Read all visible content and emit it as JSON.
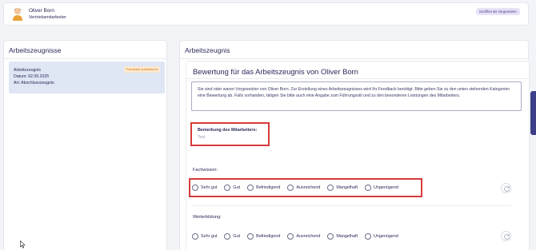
{
  "header": {
    "user_name": "Oliver Born",
    "user_role": "Vertriebsmitarbeiter",
    "badge": "Geöffnet als Vorgesetzter"
  },
  "left": {
    "title": "Arbeitszeugnisse",
    "item": {
      "title": "Arbeitszeugnis",
      "date": "Datum: 02.09.2025",
      "type": "Art: Abschlusszeugnis",
      "badge": "Feedback ausstehend"
    }
  },
  "right": {
    "title": "Arbeitszeugnis",
    "heading": "Bewertung für das Arbeitszeugnis von Oliver Born",
    "info": "Sie sind oder waren Vorgesetzter von Oliver Born. Zur Erstellung eines Arbeitszeugnisses wird Ihr Feedback benötigt. Bitte geben Sie zu den unten stehenden Kategorien eine Bewertung ab. Falls vorhanden, tätigen Sie bitte auch eine Angabe zum Führungsstil und zu den besonderen Leistungen des Mitarbeiters.",
    "remark_label": "Bemerkung des Mitarbeiters:",
    "remark_value": "Test",
    "sections": [
      {
        "label": "Fachwissen:"
      },
      {
        "label": "Weiterbildung:"
      }
    ],
    "options": [
      "Sehr gut",
      "Gut",
      "Befriedigend",
      "Ausreichend",
      "Mangelhaft",
      "Ungenügend"
    ]
  },
  "colors": {
    "accent": "#3d3f88",
    "highlight": "#d63b3b",
    "item_bg": "#dfe6f4",
    "badge_orange": "#c47410"
  }
}
